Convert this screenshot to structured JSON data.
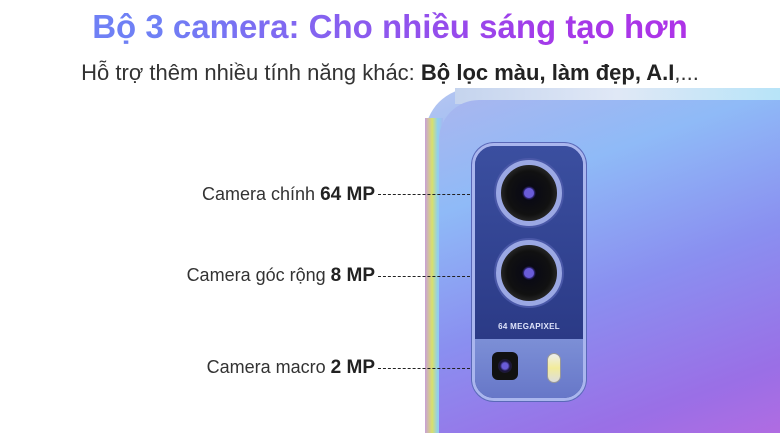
{
  "header": {
    "title": "Bộ 3 camera: Cho nhiều sáng tạo hơn",
    "subtitle_prefix": "Hỗ trợ thêm nhiều tính năng khác: ",
    "subtitle_bold": "Bộ lọc màu, làm đẹp, A.I",
    "subtitle_suffix": ",..."
  },
  "module": {
    "badge": "64 MEGAPIXEL"
  },
  "labels": [
    {
      "text": "Camera chính ",
      "value": "64 MP"
    },
    {
      "text": "Camera góc rộng ",
      "value": "8 MP"
    },
    {
      "text": "Camera macro ",
      "value": "2 MP"
    }
  ]
}
